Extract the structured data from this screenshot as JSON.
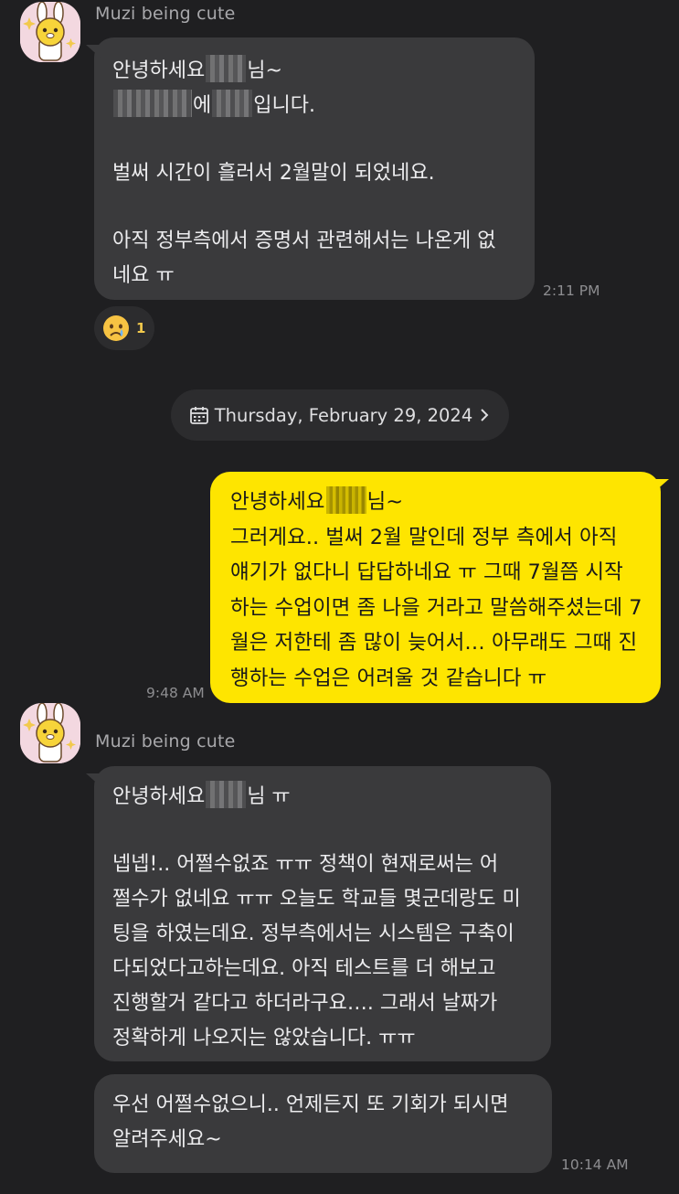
{
  "messages": [
    {
      "sender": "Muzi being cute",
      "lines": [
        "안녕하세요",
        "님~",
        "에",
        "입니다.",
        "벌써 시간이 흘러서 2월말이 되었네요.",
        "아직 정부측에서 증명서 관련해서는 나온게 없",
        "네요 ㅠ"
      ],
      "time": "2:11 PM",
      "reaction": {
        "emoji": "crying-face",
        "count": "1"
      }
    }
  ],
  "date_divider": "Thursday, February 29, 2024",
  "my_message": {
    "lines": [
      "안녕하세요",
      "님~",
      "그러게요.. 벌써 2월 말인데 정부 측에서 아직",
      "얘기가 없다니 답답하네요 ㅠ 그때 7월쯤 시작",
      "하는 수업이면 좀 나을 거라고 말씀해주셨는데 7",
      "월은 저한테 좀 많이 늦어서… 아무래도 그때 진",
      "행하는 수업은 어려울 것 같습니다 ㅠ"
    ],
    "time": "9:48 AM"
  },
  "reply": {
    "sender": "Muzi being cute",
    "bubble1": [
      "안녕하세요",
      "님 ㅠ",
      "넵넵!.. 어쩔수없죠 ㅠㅠ 정책이 현재로써는 어",
      "쩔수가 없네요 ㅠㅠ 오늘도 학교들 몇군데랑도 미",
      "팅을 하였는데요. 정부측에서는 시스템은 구축이",
      "다되었다고하는데요. 아직 테스트를 더 해보고",
      "진행할거 같다고 하더라구요…. 그래서 날짜가",
      "정확하게 나오지는 않았습니다. ㅠㅠ"
    ],
    "bubble2": [
      "우선 어쩔수없으니.. 언제든지 또 기회가 되시면",
      "알려주세요~"
    ],
    "time": "10:14 AM"
  },
  "colors": {
    "background": "#1f1f21",
    "incoming_bubble": "#3a3a3c",
    "outgoing_bubble": "#fee500"
  }
}
